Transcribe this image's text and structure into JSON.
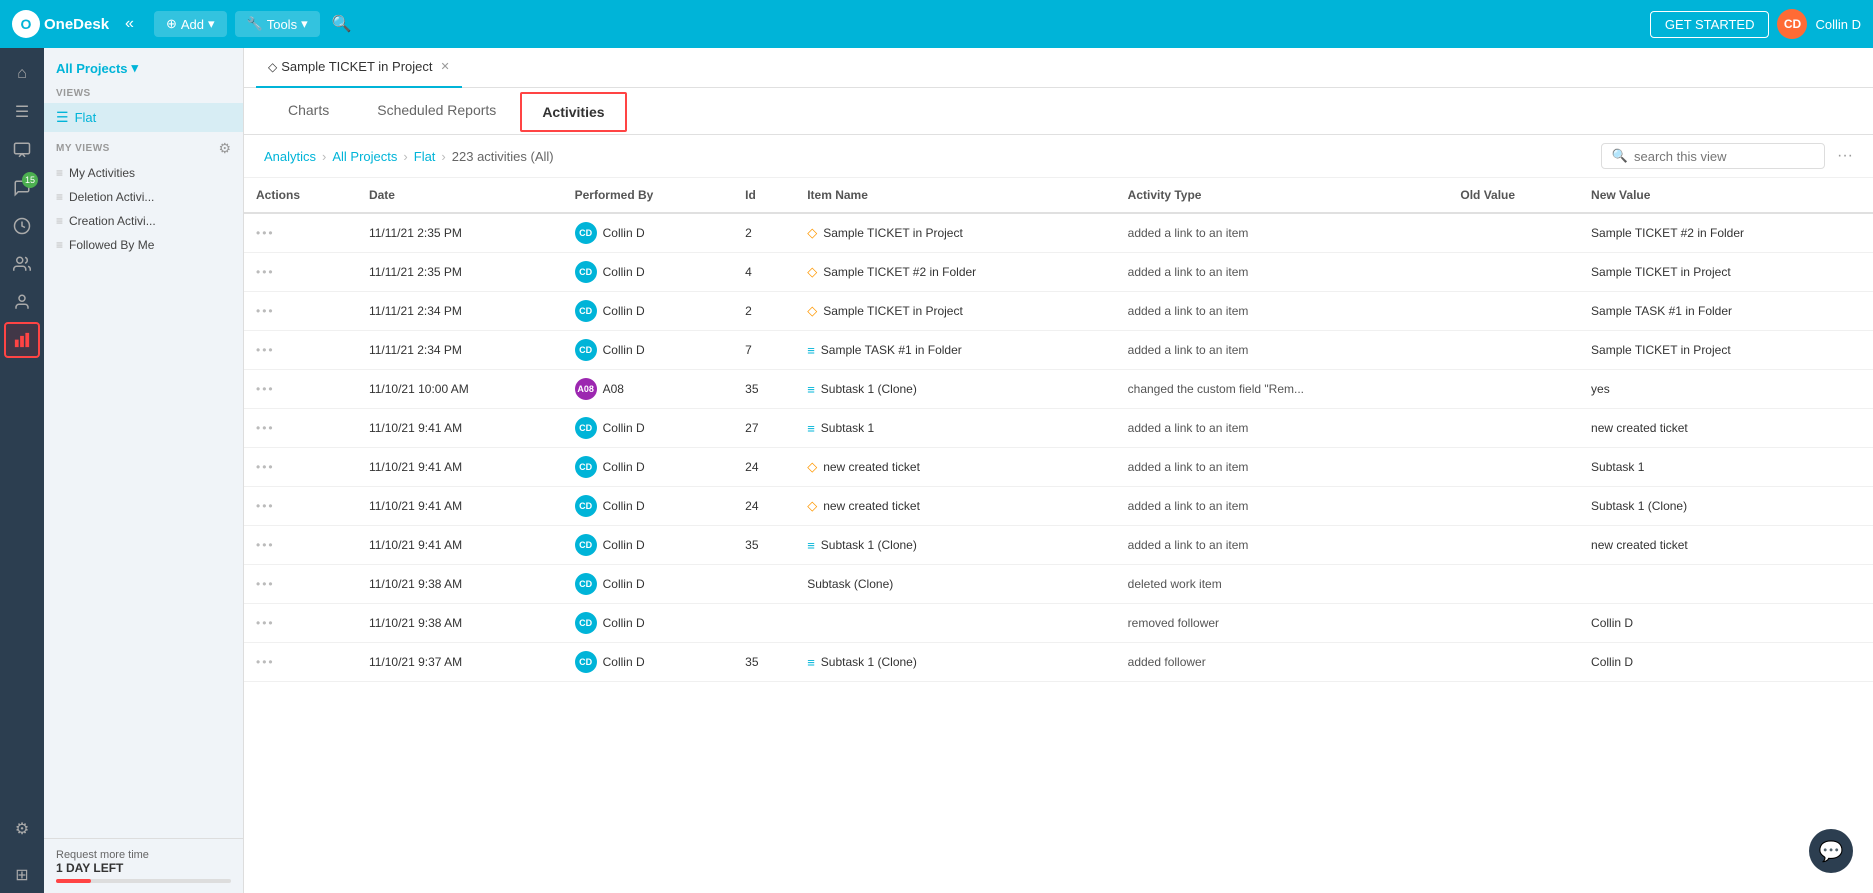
{
  "app": {
    "name": "OneDesk"
  },
  "topnav": {
    "add_label": "Add",
    "tools_label": "Tools",
    "get_started_label": "GET STARTED",
    "user_initials": "CD",
    "user_name": "Collin D"
  },
  "sidebar": {
    "all_projects_label": "All Projects",
    "views_label": "VIEWS",
    "flat_view_label": "Flat",
    "my_views_label": "MY VIEWS",
    "my_views_settings_icon": "⚙",
    "my_views": [
      {
        "label": "My Activities"
      },
      {
        "label": "Deletion Activi..."
      },
      {
        "label": "Creation Activi..."
      },
      {
        "label": "Followed By Me"
      }
    ],
    "request_label": "Request more time",
    "day_left_label": "1 DAY LEFT"
  },
  "tabs": {
    "active_tab_label": "Sample TICKET in Project",
    "active_tab_icon": "◇"
  },
  "content_tabs": [
    {
      "id": "charts",
      "label": "Charts"
    },
    {
      "id": "scheduled_reports",
      "label": "Scheduled Reports"
    },
    {
      "id": "activities",
      "label": "Activities",
      "active": true
    }
  ],
  "breadcrumb": {
    "analytics": "Analytics",
    "all_projects": "All Projects",
    "flat": "Flat",
    "count": "223 activities (All)"
  },
  "search": {
    "placeholder": "search this view"
  },
  "table": {
    "columns": [
      {
        "id": "actions",
        "label": "Actions"
      },
      {
        "id": "date",
        "label": "Date"
      },
      {
        "id": "performed_by",
        "label": "Performed By"
      },
      {
        "id": "id",
        "label": "Id"
      },
      {
        "id": "item_name",
        "label": "Item Name"
      },
      {
        "id": "activity_type",
        "label": "Activity Type"
      },
      {
        "id": "old_value",
        "label": "Old Value"
      },
      {
        "id": "new_value",
        "label": "New Value"
      }
    ],
    "rows": [
      {
        "date": "11/11/21 2:35 PM",
        "performer_initials": "CD",
        "performer_type": "cd",
        "performer_name": "Collin D",
        "id": "2",
        "item_type": "ticket",
        "item_name": "Sample TICKET in Project",
        "activity_type": "added a link to an item",
        "old_value": "",
        "new_value": "Sample TICKET #2 in Folder"
      },
      {
        "date": "11/11/21 2:35 PM",
        "performer_initials": "CD",
        "performer_type": "cd",
        "performer_name": "Collin D",
        "id": "4",
        "item_type": "ticket",
        "item_name": "Sample TICKET #2 in Folder",
        "activity_type": "added a link to an item",
        "old_value": "",
        "new_value": "Sample TICKET in Project"
      },
      {
        "date": "11/11/21 2:34 PM",
        "performer_initials": "CD",
        "performer_type": "cd",
        "performer_name": "Collin D",
        "id": "2",
        "item_type": "ticket",
        "item_name": "Sample TICKET in Project",
        "activity_type": "added a link to an item",
        "old_value": "",
        "new_value": "Sample TASK #1 in Folder"
      },
      {
        "date": "11/11/21 2:34 PM",
        "performer_initials": "CD",
        "performer_type": "cd",
        "performer_name": "Collin D",
        "id": "7",
        "item_type": "task",
        "item_name": "Sample TASK #1 in Folder",
        "activity_type": "added a link to an item",
        "old_value": "",
        "new_value": "Sample TICKET in Project"
      },
      {
        "date": "11/10/21 10:00 AM",
        "performer_initials": "A08",
        "performer_type": "a08",
        "performer_name": "A08",
        "id": "35",
        "item_type": "task",
        "item_name": "Subtask 1 (Clone)",
        "activity_type": "changed the custom field \"Rem...",
        "old_value": "",
        "new_value": "yes"
      },
      {
        "date": "11/10/21 9:41 AM",
        "performer_initials": "CD",
        "performer_type": "cd",
        "performer_name": "Collin D",
        "id": "27",
        "item_type": "task",
        "item_name": "Subtask 1",
        "activity_type": "added a link to an item",
        "old_value": "",
        "new_value": "new created ticket"
      },
      {
        "date": "11/10/21 9:41 AM",
        "performer_initials": "CD",
        "performer_type": "cd",
        "performer_name": "Collin D",
        "id": "24",
        "item_type": "ticket",
        "item_name": "new created ticket",
        "activity_type": "added a link to an item",
        "old_value": "",
        "new_value": "Subtask 1"
      },
      {
        "date": "11/10/21 9:41 AM",
        "performer_initials": "CD",
        "performer_type": "cd",
        "performer_name": "Collin D",
        "id": "24",
        "item_type": "ticket",
        "item_name": "new created ticket",
        "activity_type": "added a link to an item",
        "old_value": "",
        "new_value": "Subtask 1 (Clone)"
      },
      {
        "date": "11/10/21 9:41 AM",
        "performer_initials": "CD",
        "performer_type": "cd",
        "performer_name": "Collin D",
        "id": "35",
        "item_type": "task",
        "item_name": "Subtask 1 (Clone)",
        "activity_type": "added a link to an item",
        "old_value": "",
        "new_value": "new created ticket"
      },
      {
        "date": "11/10/21 9:38 AM",
        "performer_initials": "CD",
        "performer_type": "cd",
        "performer_name": "Collin D",
        "id": "",
        "item_type": "none",
        "item_name": "Subtask (Clone)",
        "activity_type": "deleted work item",
        "old_value": "",
        "new_value": ""
      },
      {
        "date": "11/10/21 9:38 AM",
        "performer_initials": "CD",
        "performer_type": "cd",
        "performer_name": "Collin D",
        "id": "",
        "item_type": "none",
        "item_name": "",
        "activity_type": "removed follower",
        "old_value": "",
        "new_value": "Collin D"
      },
      {
        "date": "11/10/21 9:37 AM",
        "performer_initials": "CD",
        "performer_type": "cd",
        "performer_name": "Collin D",
        "id": "35",
        "item_type": "task",
        "item_name": "Subtask 1 (Clone)",
        "activity_type": "added follower",
        "old_value": "",
        "new_value": "Collin D"
      }
    ]
  },
  "icons": {
    "left_sidebar": [
      {
        "name": "home-icon",
        "glyph": "⌂"
      },
      {
        "name": "list-icon",
        "glyph": "☰"
      },
      {
        "name": "inbox-icon",
        "glyph": "☐"
      },
      {
        "name": "chat-icon",
        "glyph": "💬",
        "badge": "15"
      },
      {
        "name": "clock-icon",
        "glyph": "◷"
      },
      {
        "name": "people-icon",
        "glyph": "👥"
      },
      {
        "name": "person-icon",
        "glyph": "👤"
      },
      {
        "name": "analytics-icon",
        "glyph": "📊"
      },
      {
        "name": "settings-icon",
        "glyph": "⚙"
      },
      {
        "name": "grid-icon",
        "glyph": "⊞"
      }
    ]
  }
}
